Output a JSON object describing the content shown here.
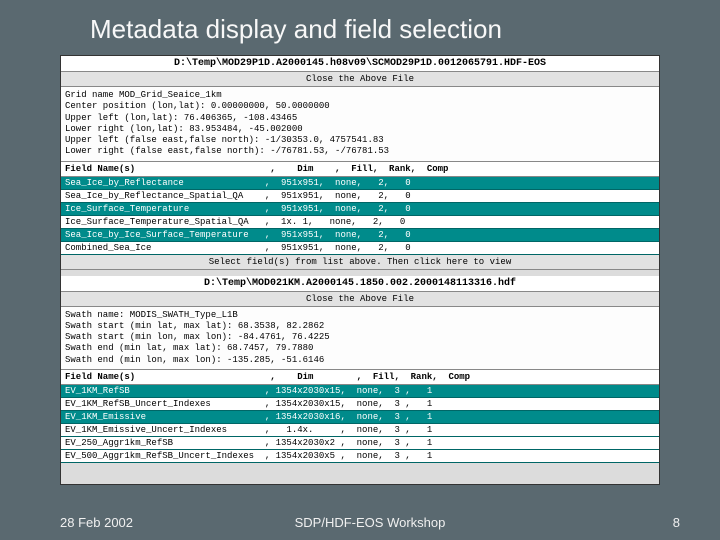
{
  "slide": {
    "title": "Metadata display and field selection",
    "date": "28 Feb 2002",
    "venue": "SDP/HDF-EOS Workshop",
    "page": "8"
  },
  "panel1": {
    "file": "D:\\Temp\\MOD29P1D.A2000145.h08v09\\SCMOD29P1D.0012065791.HDF-EOS",
    "close": "Close the Above File",
    "meta": "Grid name MOD_Grid_Seaice_1km\nCenter position (lon,lat): 0.00000000, 50.0000000\nUpper left (lon,lat): 76.406365, -108.43465\nLower right (lon,lat): 83.953484, -45.002000\nUpper left (false east,false north): -1/30353.0, 4757541.83\nLower right (false east,false north): -/76781.53, -/76781.53",
    "field_header": "Field Name(s)                         ,    Dim    ,  Fill,  Rank,  Comp",
    "rows": [
      {
        "txt": "Sea_Ice_by_Reflectance               ,  951x951,  none,   2,   0",
        "sel": true
      },
      {
        "txt": "Sea_Ice_by_Reflectance_Spatial_QA    ,  951x951,  none,   2,   0",
        "sel": false
      },
      {
        "txt": "Ice_Surface_Temperature              ,  951x951,  none,   2,   0",
        "sel": true
      },
      {
        "txt": "Ice_Surface_Temperature_Spatial_QA   ,  1x. 1,   none,   2,   0",
        "sel": false
      },
      {
        "txt": "Sea_Ice_by_Ice_Surface_Temperature   ,  951x951,  none,   2,   0",
        "sel": true
      },
      {
        "txt": "Combined_Sea_Ice                     ,  951x951,  none,   2,   0",
        "sel": false
      }
    ],
    "instruct": "Select field(s) from list above.  Then click here to view"
  },
  "panel2": {
    "file": "D:\\Temp\\MOD021KM.A2000145.1850.002.2000148113316.hdf",
    "close": "Close the Above File",
    "meta": "Swath name: MODIS_SWATH_Type_L1B\nSwath start (min lat, max lat): 68.3538, 82.2862\nSwath start (min lon, max lon): -84.4761, 76.4225\nSwath end (min lat, max lat): 68.7457, 79.7880\nSwath end (min lon, max lon): -135.285, -51.6146",
    "field_header": "Field Name(s)                         ,    Dim        ,  Fill,  Rank,  Comp",
    "rows": [
      {
        "txt": "EV_1KM_RefSB                         , 1354x2030x15,  none,  3 ,   1",
        "sel": true
      },
      {
        "txt": "EV_1KM_RefSB_Uncert_Indexes          , 1354x2030x15,  none,  3 ,   1",
        "sel": false
      },
      {
        "txt": "EV_1KM_Emissive                      , 1354x2030x16,  none,  3 ,   1",
        "sel": true
      },
      {
        "txt": "EV_1KM_Emissive_Uncert_Indexes       ,   1.4x.     ,  none,  3 ,   1",
        "sel": false
      },
      {
        "txt": "EV_250_Aggr1km_RefSB                 , 1354x2030x2 ,  none,  3 ,   1",
        "sel": false
      },
      {
        "txt": "EV_500_Aggr1km_RefSB_Uncert_Indexes  , 1354x2030x5 ,  none,  3 ,   1",
        "sel": false
      }
    ]
  }
}
